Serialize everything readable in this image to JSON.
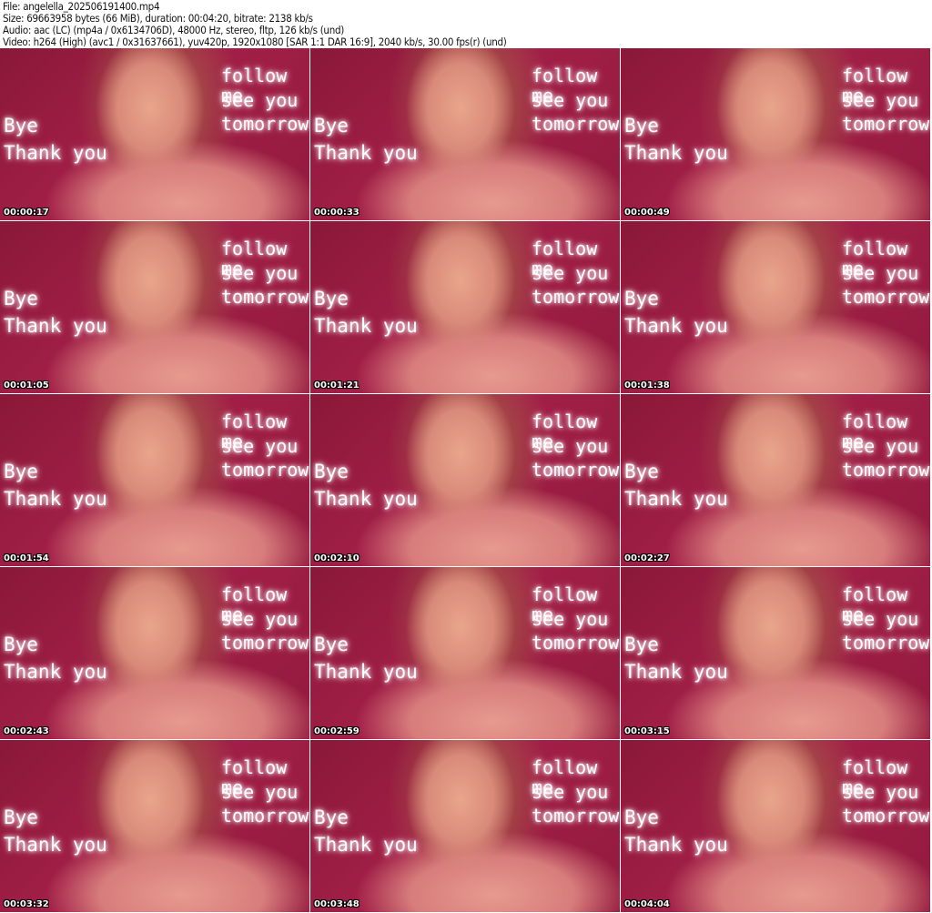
{
  "header": {
    "file": "File: angelella_202506191400.mp4",
    "size": "Size: 69663958 bytes (66 MiB), duration: 00:04:20, bitrate: 2138 kb/s",
    "audio": "Audio: aac (LC) (mp4a / 0x6134706D), 48000 Hz, stereo, fltp, 126 kb/s (und)",
    "video": "Video: h264 (High) (avc1 / 0x31637661), yuv420p, 1920x1080 [SAR 1:1 DAR 16:9], 2040 kb/s, 30.00 fps(r) (und)"
  },
  "overlay_text": {
    "right": [
      "follow me",
      "see you",
      "tomorrow"
    ],
    "left": [
      "Bye",
      "Thank you"
    ]
  },
  "thumbnails": [
    {
      "timestamp": "00:00:17"
    },
    {
      "timestamp": "00:00:33"
    },
    {
      "timestamp": "00:00:49"
    },
    {
      "timestamp": "00:01:05"
    },
    {
      "timestamp": "00:01:21"
    },
    {
      "timestamp": "00:01:38"
    },
    {
      "timestamp": "00:01:54"
    },
    {
      "timestamp": "00:02:10"
    },
    {
      "timestamp": "00:02:27"
    },
    {
      "timestamp": "00:02:43"
    },
    {
      "timestamp": "00:02:59"
    },
    {
      "timestamp": "00:03:15"
    },
    {
      "timestamp": "00:03:32"
    },
    {
      "timestamp": "00:03:48"
    },
    {
      "timestamp": "00:04:04"
    }
  ]
}
